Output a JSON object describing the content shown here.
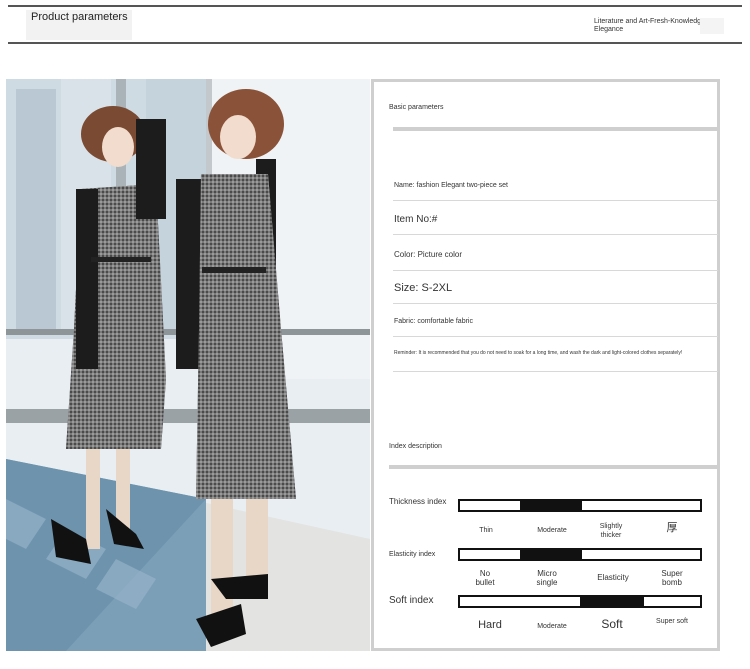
{
  "header": {
    "title": "Product parameters",
    "tagline": "Literature and Art-Fresh-Knowledge -Elegance"
  },
  "basic": {
    "section_label": "Basic parameters",
    "name": "Name: fashion Elegant two-piece set",
    "item_no": "Item No:#",
    "color": "Color: Picture color",
    "size": "Size: S-2XL",
    "fabric": "Fabric: comfortable fabric",
    "reminder": "Reminder: It is recommended that you do not need to soak for a long time, and wash the dark and light-colored clothes separately!"
  },
  "index": {
    "section_label": "Index description",
    "thickness": {
      "label": "Thickness index",
      "levels": [
        "Thin",
        "Moderate",
        "Slightly thicker",
        "厚"
      ],
      "selected": 1
    },
    "elasticity": {
      "label": "Elasticity index",
      "levels": [
        "No bullet",
        "Micro single",
        "Elasticity",
        "Super bomb"
      ],
      "selected": 1
    },
    "soft": {
      "label": "Soft index",
      "levels": [
        "Hard",
        "Moderate",
        "Soft",
        "Super soft"
      ],
      "selected": 2
    }
  },
  "colors": {
    "track": "#111111",
    "card_border": "#cfcfcf"
  }
}
